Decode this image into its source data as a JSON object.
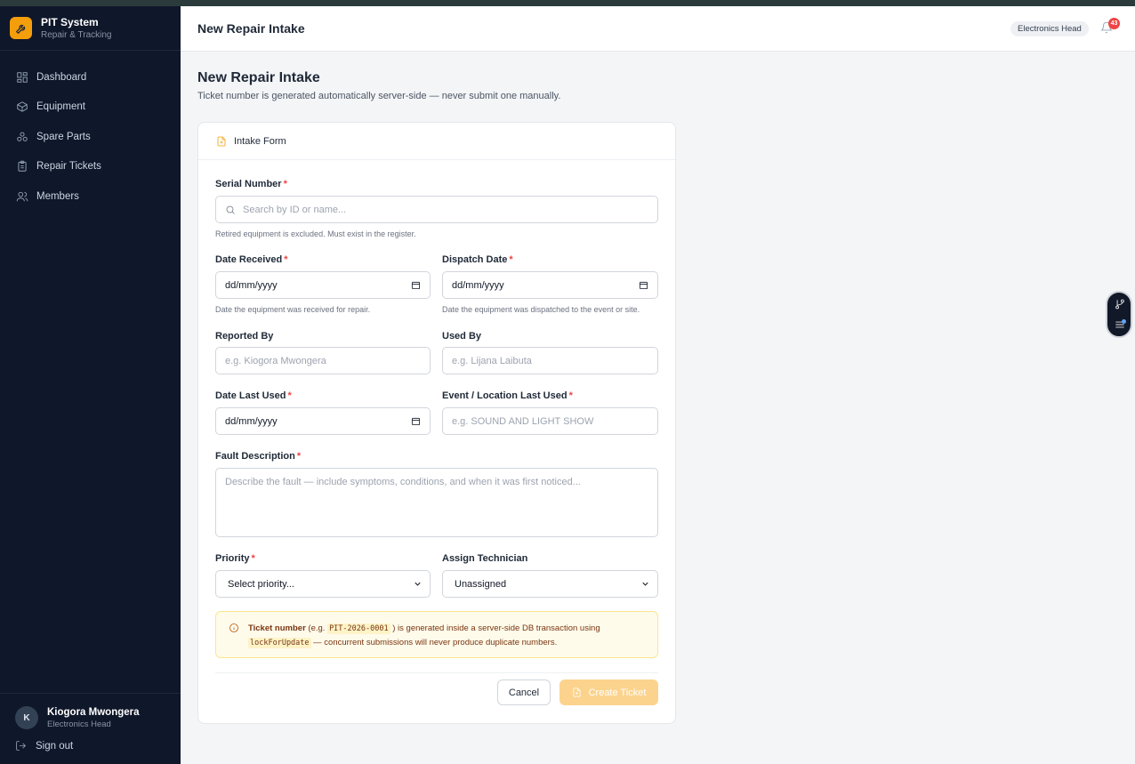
{
  "app": {
    "name": "PIT System",
    "tagline": "Repair & Tracking"
  },
  "sidebar": {
    "items": [
      {
        "label": "Dashboard",
        "icon": "grid-icon"
      },
      {
        "label": "Equipment",
        "icon": "box-icon"
      },
      {
        "label": "Spare Parts",
        "icon": "parts-icon"
      },
      {
        "label": "Repair Tickets",
        "icon": "clipboard-icon"
      },
      {
        "label": "Members",
        "icon": "users-icon"
      }
    ],
    "user": {
      "initial": "K",
      "name": "Kiogora Mwongera",
      "role": "Electronics Head"
    },
    "signout_label": "Sign out"
  },
  "header": {
    "title": "New Repair Intake",
    "role_badge": "Electronics Head",
    "notification_count": "43"
  },
  "page": {
    "heading": "New Repair Intake",
    "subtitle": "Ticket number is generated automatically server-side — never submit one manually."
  },
  "form": {
    "card_title": "Intake Form",
    "serial": {
      "label": "Serial Number",
      "placeholder": "Search by ID or name...",
      "hint": "Retired equipment is excluded. Must exist in the register."
    },
    "date_received": {
      "label": "Date Received",
      "value": "dd/mm/yyyy",
      "hint": "Date the equipment was received for repair."
    },
    "dispatch_date": {
      "label": "Dispatch Date",
      "value": "dd/mm/yyyy",
      "hint": "Date the equipment was dispatched to the event or site."
    },
    "reported_by": {
      "label": "Reported By",
      "placeholder": "e.g. Kiogora Mwongera"
    },
    "used_by": {
      "label": "Used By",
      "placeholder": "e.g. Lijana Laibuta"
    },
    "date_last_used": {
      "label": "Date Last Used",
      "value": "dd/mm/yyyy"
    },
    "event_location": {
      "label": "Event / Location Last Used",
      "placeholder": "e.g. SOUND AND LIGHT SHOW"
    },
    "fault": {
      "label": "Fault Description",
      "placeholder": "Describe the fault — include symptoms, conditions, and when it was first noticed..."
    },
    "priority": {
      "label": "Priority",
      "value": "Select priority..."
    },
    "technician": {
      "label": "Assign Technician",
      "value": "Unassigned"
    },
    "required_mark": "*",
    "notice": {
      "bold": "Ticket number",
      "part1": " (e.g. ",
      "code1": "PIT-2026-0001",
      "part2": " ) is generated inside a server-side DB transaction using",
      "code2": "lockForUpdate",
      "part3": " — concurrent submissions will never produce duplicate numbers."
    },
    "cancel_label": "Cancel",
    "create_label": "Create Ticket"
  },
  "colors": {
    "accent": "#f59e0b",
    "sidebar_bg": "#0f172a",
    "danger": "#ef4444"
  }
}
